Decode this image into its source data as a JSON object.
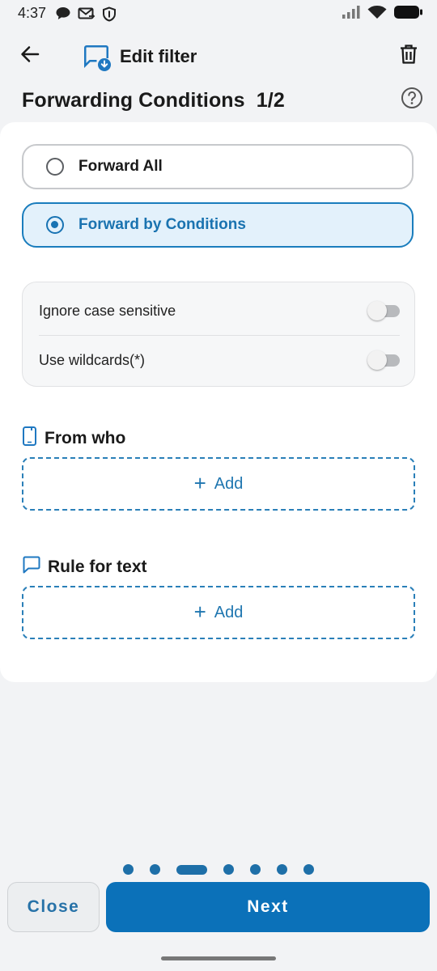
{
  "status_bar": {
    "time": "4:37",
    "left_icons": [
      "chat-bubble-icon",
      "mail-forward-icon",
      "shield-icon"
    ],
    "right_icons": [
      "signal-icon",
      "wifi-icon",
      "battery-icon"
    ]
  },
  "app_bar": {
    "title": "Edit filter",
    "back_icon": "arrow-left-icon",
    "app_icon": "message-download-icon",
    "delete_icon": "trash-icon"
  },
  "section": {
    "title": "Forwarding Conditions",
    "step": "1/2",
    "help_icon": "help-circle-icon"
  },
  "options": {
    "forward_all": "Forward All",
    "forward_by_conditions": "Forward by Conditions",
    "selected": "forward_by_conditions"
  },
  "settings": [
    {
      "label": "Ignore case sensitive",
      "enabled": false
    },
    {
      "label": "Use wildcards(*)",
      "enabled": false
    }
  ],
  "groups": {
    "from_who": {
      "title": "From who",
      "icon": "phone-icon",
      "add_label": "Add"
    },
    "rule_for_text": {
      "title": "Rule for text",
      "icon": "message-icon",
      "add_label": "Add"
    }
  },
  "pager": {
    "total": 7,
    "current": 3
  },
  "footer": {
    "close_label": "Close",
    "next_label": "Next"
  },
  "colors": {
    "accent": "#0b71b9",
    "selected_bg": "#e3f1fb",
    "background": "#f2f3f5"
  }
}
